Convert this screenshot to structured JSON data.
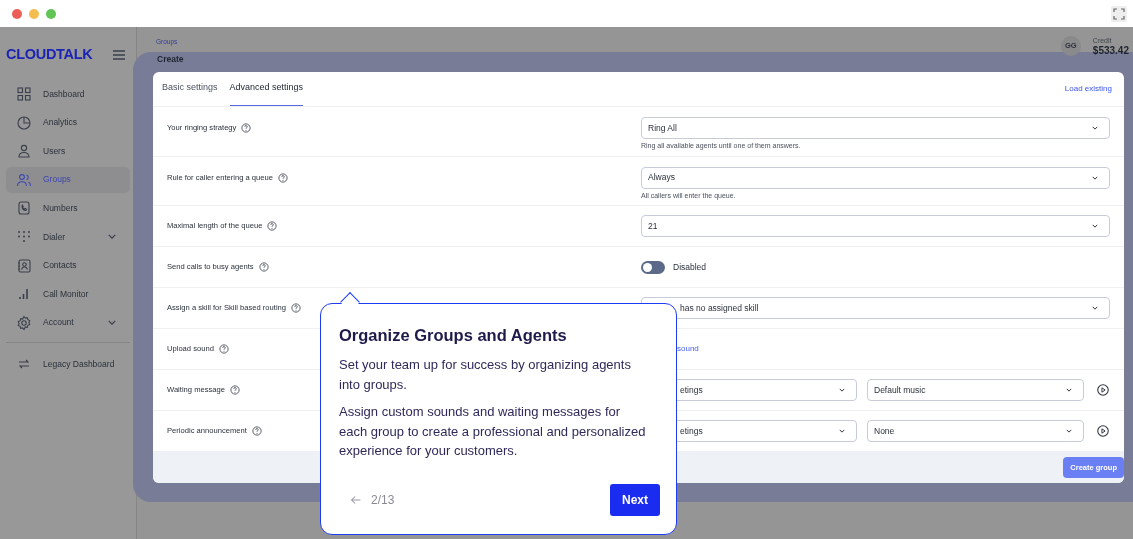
{
  "sidebar": {
    "logo": "CLOUDTALK",
    "items": [
      {
        "label": "Dashboard",
        "selected": false,
        "has_submenu": false
      },
      {
        "label": "Analytics",
        "selected": false,
        "has_submenu": false
      },
      {
        "label": "Users",
        "selected": false,
        "has_submenu": false
      },
      {
        "label": "Groups",
        "selected": true,
        "has_submenu": false
      },
      {
        "label": "Numbers",
        "selected": false,
        "has_submenu": false
      },
      {
        "label": "Dialer",
        "selected": false,
        "has_submenu": true
      },
      {
        "label": "Contacts",
        "selected": false,
        "has_submenu": false
      },
      {
        "label": "Call Monitor",
        "selected": false,
        "has_submenu": false
      },
      {
        "label": "Account",
        "selected": false,
        "has_submenu": true
      }
    ],
    "footer_items": [
      {
        "label": "Legacy Dashboard",
        "selected": false
      }
    ]
  },
  "header": {
    "breadcrumb": "Groups",
    "title": "Create",
    "avatar_initials": "GG",
    "credit_label": "Credit",
    "credit": "$533.42"
  },
  "card": {
    "tabs": [
      {
        "label": "Basic settings",
        "selected": false
      },
      {
        "label": "Advanced settings",
        "selected": true
      }
    ],
    "load_existing": "Load existing",
    "rows": [
      {
        "label": "Your ringing strategy",
        "kind": "select",
        "value": "Ring All",
        "hint": "Ring all available agents until one of them answers."
      },
      {
        "label": "Rule for caller entering a queue",
        "kind": "select",
        "value": "Always",
        "hint": "All callers will enter the queue."
      },
      {
        "label": "Maximal length of the queue",
        "kind": "select",
        "value": "21"
      },
      {
        "label": "Send calls to busy agents",
        "kind": "toggle",
        "on": false,
        "value": "Disabled"
      },
      {
        "label": "Assign a skill for Skill based routing",
        "kind": "select",
        "value": "has no assigned skill"
      },
      {
        "label": "Upload sound",
        "kind": "link",
        "value": "sound"
      },
      {
        "label": "Waiting message",
        "kind": "sound_pair",
        "values": [
          "etings",
          "Default music"
        ]
      },
      {
        "label": "Periodic announcement",
        "kind": "sound_pair",
        "values": [
          "etings",
          "None"
        ]
      }
    ],
    "create_button": "Create group"
  },
  "tour": {
    "title": "Organize Groups and Agents",
    "paragraphs": [
      "Set your team up for success by organizing agents into groups.",
      "Assign custom sounds and waiting messages for each group to create a professional and personalized experience for your customers."
    ],
    "step": "2/13",
    "next": "Next"
  }
}
